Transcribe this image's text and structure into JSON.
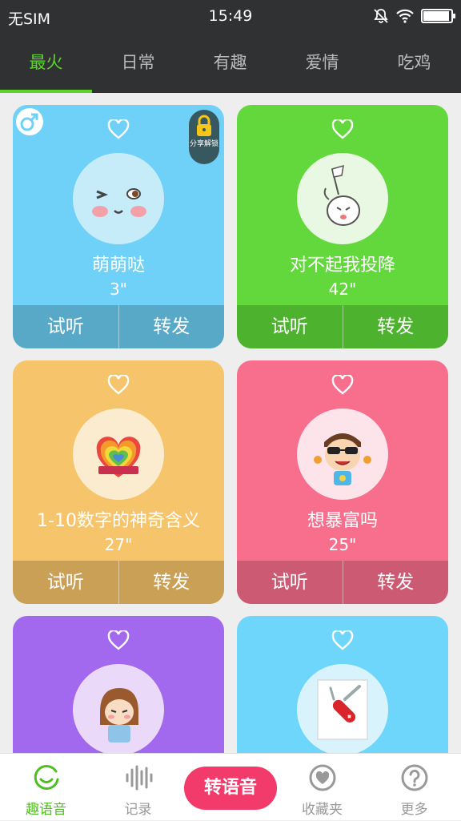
{
  "status_bar": {
    "carrier": "无SIM",
    "time": "15:49",
    "battery_level": 0.95
  },
  "tabs": [
    {
      "label": "最火",
      "active": true
    },
    {
      "label": "日常",
      "active": false
    },
    {
      "label": "有趣",
      "active": false
    },
    {
      "label": "爱情",
      "active": false
    },
    {
      "label": "吃鸡",
      "active": false
    }
  ],
  "lock_badge": "分享解锁",
  "cards": [
    {
      "title": "萌萌哒",
      "duration": "3\"",
      "listen": "试听",
      "forward": "转发",
      "color": "#6fd1f7",
      "bar_color": "#58a9c8"
    },
    {
      "title": "对不起我投降",
      "duration": "42\"",
      "listen": "试听",
      "forward": "转发",
      "color": "#63d83c",
      "bar_color": "#4db32f"
    },
    {
      "title": "1-10数字的神奇含义",
      "duration": "27\"",
      "listen": "试听",
      "forward": "转发",
      "color": "#f6c46b",
      "bar_color": "#c9a056"
    },
    {
      "title": "想暴富吗",
      "duration": "25\"",
      "listen": "试听",
      "forward": "转发",
      "color": "#f86f8e",
      "bar_color": "#cc5a73"
    },
    {
      "color": "#a268ee"
    },
    {
      "color": "#6fd6fb"
    }
  ],
  "bottom_nav": {
    "items": [
      {
        "label": "趣语音",
        "icon": "smile-icon",
        "active": true
      },
      {
        "label": "记录",
        "icon": "soundwave-icon",
        "active": false
      },
      {
        "label": "收藏夹",
        "icon": "heart-circle-icon",
        "active": false
      },
      {
        "label": "更多",
        "icon": "question-icon",
        "active": false
      }
    ],
    "center_button": "转语音"
  }
}
